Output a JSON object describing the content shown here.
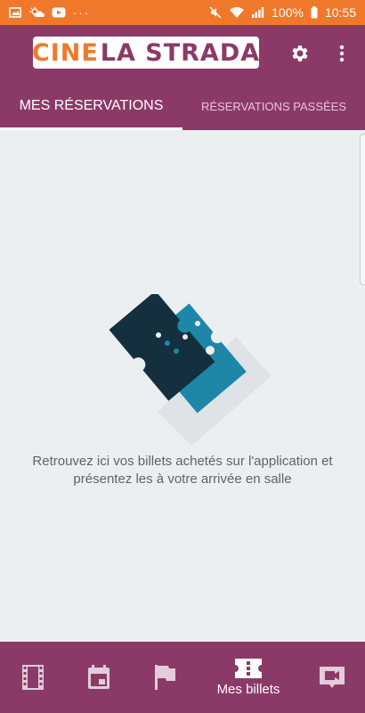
{
  "status_bar": {
    "battery": "100%",
    "time": "10:55",
    "notification_icons": [
      "image-icon",
      "weather-icon",
      "youtube-icon",
      "more-dots-icon"
    ],
    "system_icons": [
      "mute-icon",
      "wifi-icon",
      "signal-icon",
      "battery-icon"
    ],
    "background": "#f0782a"
  },
  "app_bar": {
    "logo": {
      "part1": "CINE",
      "part2": "LA STRADA"
    },
    "background": "#8b3a68",
    "accent": "#f07a2a"
  },
  "tabs": [
    {
      "label": "Mes réservations",
      "active": true
    },
    {
      "label": "Réservations passées",
      "active": false
    }
  ],
  "empty_state": {
    "message": "Retrouvez ici vos billets achetés sur l'application et présentez les à votre arrivée en salle"
  },
  "bottom_nav": {
    "items": [
      {
        "icon": "film-strip-icon",
        "label": "",
        "active": false
      },
      {
        "icon": "calendar-icon",
        "label": "",
        "active": false
      },
      {
        "icon": "flag-icon",
        "label": "",
        "active": false
      },
      {
        "icon": "ticket-icon",
        "label": "Mes billets",
        "active": true
      },
      {
        "icon": "video-camera-icon",
        "label": "",
        "active": false
      }
    ]
  }
}
